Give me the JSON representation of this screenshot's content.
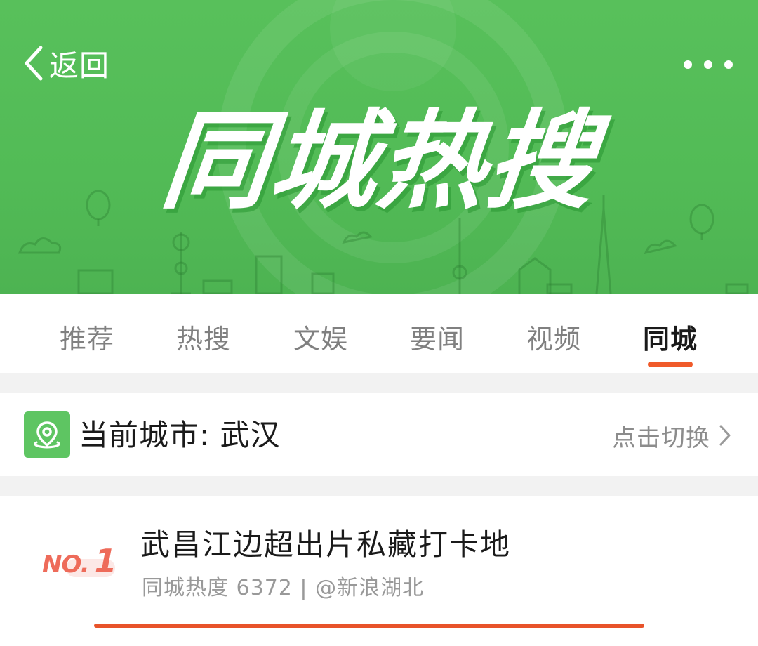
{
  "header": {
    "back_label": "返回",
    "more_icon": "more-dots-icon",
    "banner_title": "同城热搜"
  },
  "tabs": [
    {
      "label": "推荐",
      "active": false
    },
    {
      "label": "热搜",
      "active": false
    },
    {
      "label": "文娱",
      "active": false
    },
    {
      "label": "要闻",
      "active": false
    },
    {
      "label": "视频",
      "active": false
    },
    {
      "label": "同城",
      "active": true
    }
  ],
  "city": {
    "icon": "location-pin-icon",
    "label": "当前城市: 武汉",
    "switch_label": "点击切换"
  },
  "list": {
    "items": [
      {
        "rank_prefix": "NO.",
        "rank_number": "1",
        "title": "武昌江边超出片私藏打卡地",
        "meta": "同城热度 6372 | @新浪湖北"
      }
    ]
  },
  "colors": {
    "banner_green": "#52bb56",
    "accent_orange": "#e8532a",
    "rank_red": "#ee6b5a",
    "city_icon_green": "#5ec562"
  }
}
